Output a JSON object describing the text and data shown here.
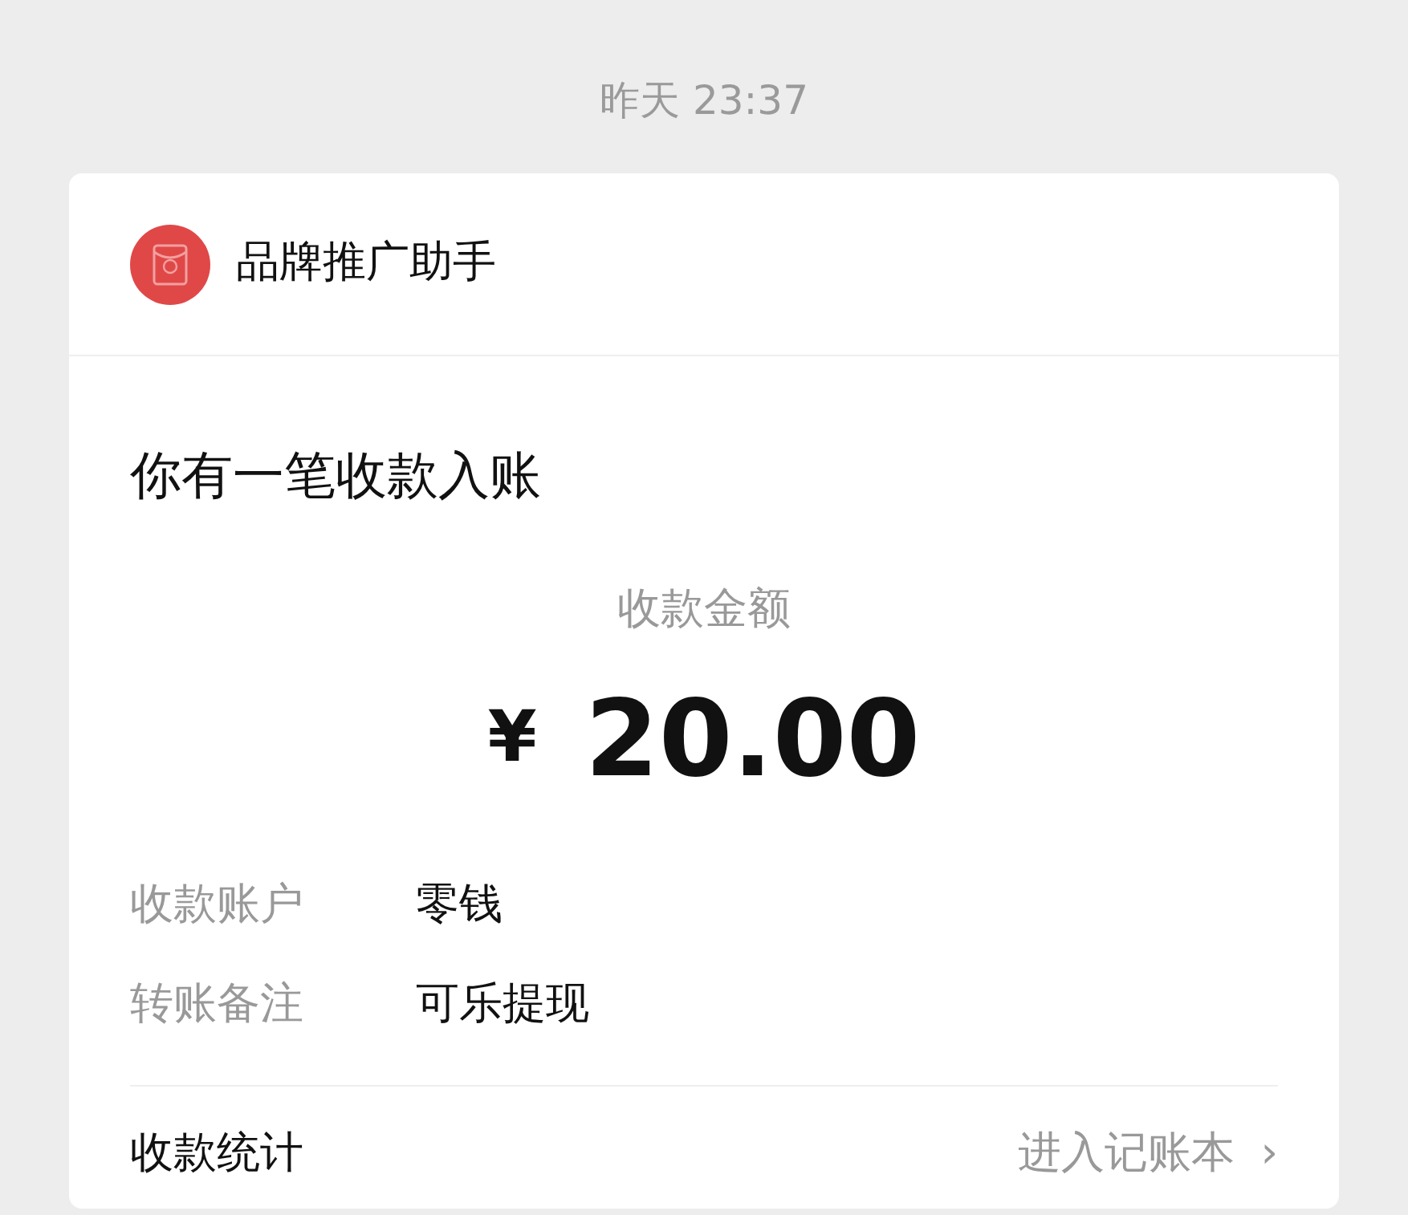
{
  "timestamp": "昨天 23:37",
  "card": {
    "sender": "品牌推广助手",
    "headline": "你有一笔收款入账",
    "amount_label": "收款金额",
    "currency": "¥",
    "amount": "20.00",
    "details": [
      {
        "label": "收款账户",
        "value": "零钱"
      },
      {
        "label": "转账备注",
        "value": "可乐提现"
      }
    ],
    "footer": {
      "label": "收款统计",
      "link": "进入记账本",
      "chevron": "›"
    }
  }
}
